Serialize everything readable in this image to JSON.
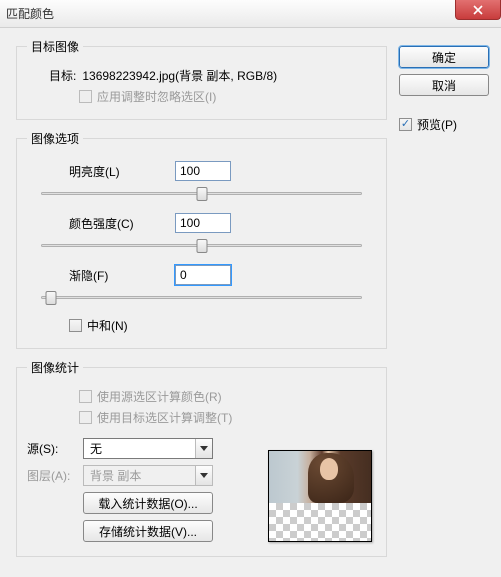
{
  "window": {
    "title": "匹配颜色"
  },
  "buttons": {
    "ok": "确定",
    "cancel": "取消"
  },
  "preview": {
    "label": "预览(P)",
    "checked": true
  },
  "destImage": {
    "legend": "目标图像",
    "targetLabel": "目标:",
    "targetValue": "13698223942.jpg(背景 副本, RGB/8)",
    "ignoreSel": "应用调整时忽略选区(I)"
  },
  "imageOptions": {
    "legend": "图像选项",
    "luminance": {
      "label": "明亮度(L)",
      "value": "100",
      "pos": 50
    },
    "intensity": {
      "label": "颜色强度(C)",
      "value": "100",
      "pos": 50
    },
    "fade": {
      "label": "渐隐(F)",
      "value": "0",
      "pos": 3
    },
    "neutralize": "中和(N)"
  },
  "stats": {
    "legend": "图像统计",
    "useSourceSel": "使用源选区计算颜色(R)",
    "useTargetSel": "使用目标选区计算调整(T)",
    "sourceLabel": "源(S):",
    "sourceValue": "无",
    "layerLabel": "图层(A):",
    "layerValue": "背景 副本",
    "loadBtn": "载入统计数据(O)...",
    "saveBtn": "存储统计数据(V)..."
  }
}
